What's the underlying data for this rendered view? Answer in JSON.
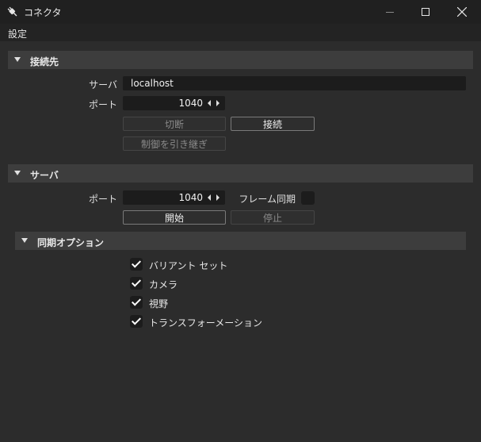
{
  "window": {
    "title": "コネクタ",
    "icon": "plug-icon"
  },
  "menu": {
    "settings": "設定"
  },
  "connection": {
    "header": "接続先",
    "server_label": "サーバ",
    "server_value": "localhost",
    "port_label": "ポート",
    "port_value": "1040",
    "disconnect_label": "切断",
    "connect_label": "接続",
    "takeover_label": "制御を引き継ぎ"
  },
  "server": {
    "header": "サーバ",
    "port_label": "ポート",
    "port_value": "1040",
    "frame_sync_label": "フレーム同期",
    "start_label": "開始",
    "stop_label": "停止"
  },
  "sync_options": {
    "header": "同期オプション",
    "items": [
      {
        "label": "バリアント セット",
        "checked": true
      },
      {
        "label": "カメラ",
        "checked": true
      },
      {
        "label": "視野",
        "checked": true
      },
      {
        "label": "トランスフォーメーション",
        "checked": true
      }
    ]
  },
  "colors": {
    "background": "#2b2b2b",
    "titlebar": "#202020",
    "section_header": "#3d3d3d",
    "field": "#1c1c1c"
  }
}
